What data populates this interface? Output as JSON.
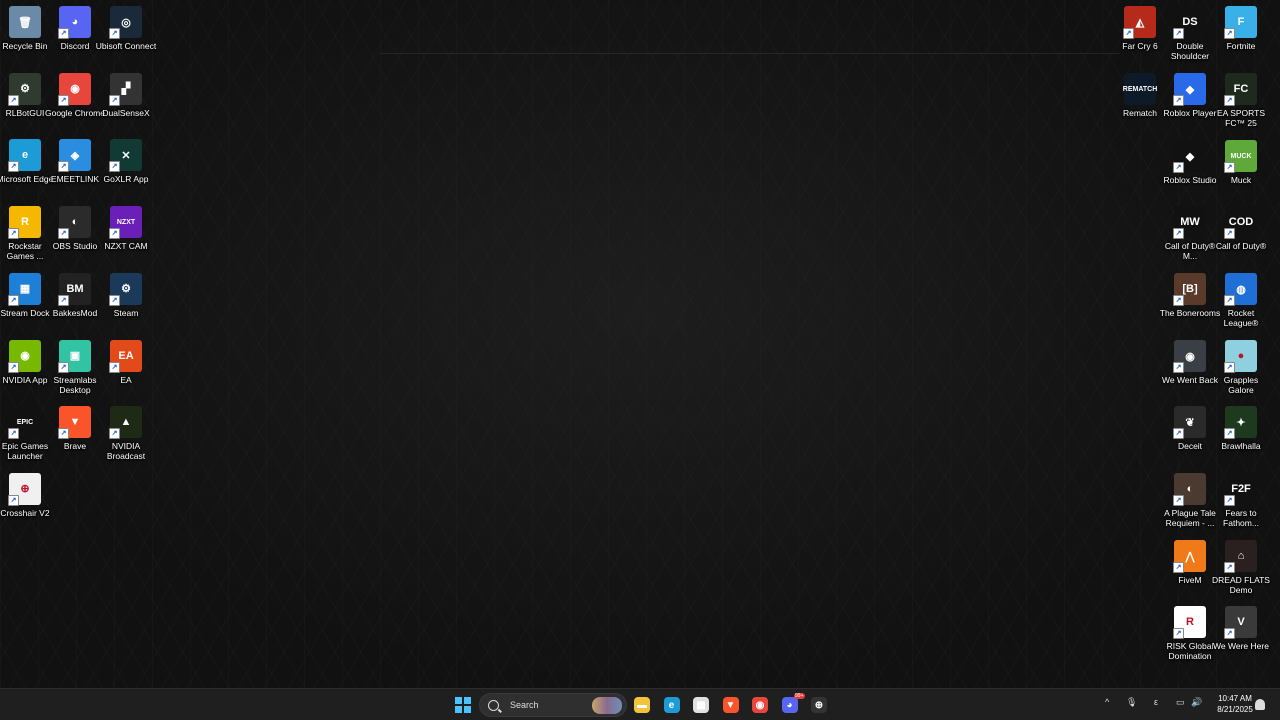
{
  "desktop": {
    "icons_left": [
      {
        "label": "Recycle Bin",
        "icon": "recycle-bin-icon",
        "bg": "#6b8aa8",
        "glyph": "🗑",
        "shortcut": false
      },
      {
        "label": "Discord",
        "icon": "discord-icon",
        "bg": "#5865f2",
        "glyph": "◕",
        "shortcut": true
      },
      {
        "label": "Ubisoft Connect",
        "icon": "ubisoft-icon",
        "bg": "#1a2a3a",
        "glyph": "◎",
        "shortcut": true
      },
      {
        "label": "RLBotGUI",
        "icon": "rlbot-icon",
        "bg": "#2e3b2e",
        "glyph": "⚙",
        "shortcut": true
      },
      {
        "label": "Google Chrome",
        "icon": "chrome-icon",
        "bg": "#e8453c",
        "glyph": "◉",
        "shortcut": true
      },
      {
        "label": "DualSenseX",
        "icon": "dualsensex-icon",
        "bg": "#333333",
        "glyph": "▞",
        "shortcut": true
      },
      {
        "label": "Microsoft Edge",
        "icon": "edge-icon",
        "bg": "#1d9bd6",
        "glyph": "e",
        "shortcut": true
      },
      {
        "label": "EMEETLINK",
        "icon": "emeetlink-icon",
        "bg": "#2a8de0",
        "glyph": "◈",
        "shortcut": true
      },
      {
        "label": "GoXLR App",
        "icon": "goxlr-icon",
        "bg": "#123a34",
        "glyph": "✕",
        "shortcut": true
      },
      {
        "label": "Rockstar Games ...",
        "icon": "rockstar-icon",
        "bg": "#f5b800",
        "glyph": "R",
        "shortcut": true
      },
      {
        "label": "OBS Studio",
        "icon": "obs-icon",
        "bg": "#2b2b2b",
        "glyph": "◐",
        "shortcut": true
      },
      {
        "label": "NZXT CAM",
        "icon": "nzxt-icon",
        "bg": "#6a1fb8",
        "glyph": "NZXT",
        "shortcut": true
      },
      {
        "label": "Stream Dock",
        "icon": "stream-dock-icon",
        "bg": "#1e7fd6",
        "glyph": "▦",
        "shortcut": true
      },
      {
        "label": "BakkesMod",
        "icon": "bakkesmod-icon",
        "bg": "#222222",
        "glyph": "BM",
        "shortcut": true
      },
      {
        "label": "Steam",
        "icon": "steam-icon",
        "bg": "#1b3a5a",
        "glyph": "⚙",
        "shortcut": true
      },
      {
        "label": "NVIDIA App",
        "icon": "nvidia-app-icon",
        "bg": "#76b900",
        "glyph": "◉",
        "shortcut": true
      },
      {
        "label": "Streamlabs Desktop",
        "icon": "streamlabs-icon",
        "bg": "#31c3a2",
        "glyph": "▣",
        "shortcut": true
      },
      {
        "label": "EA",
        "icon": "ea-icon",
        "bg": "#e34a1a",
        "glyph": "EA",
        "shortcut": true
      },
      {
        "label": "Epic Games Launcher",
        "icon": "epic-games-icon",
        "bg": "#111111",
        "glyph": "EPIC",
        "shortcut": true
      },
      {
        "label": "Brave",
        "icon": "brave-icon",
        "bg": "#fb542b",
        "glyph": "▼",
        "shortcut": true
      },
      {
        "label": "NVIDIA Broadcast",
        "icon": "nvidia-broadcast-icon",
        "bg": "#1f2a16",
        "glyph": "▲",
        "shortcut": true
      },
      {
        "label": "Crosshair V2",
        "icon": "crosshair-icon",
        "bg": "#f0f0f0",
        "glyph": "⊕",
        "shortcut": true
      }
    ],
    "icons_right": [
      {
        "label": "Far Cry 6",
        "icon": "far-cry-6-icon",
        "bg": "#b52a1a",
        "glyph": "◭",
        "shortcut": true
      },
      {
        "label": "Double Shouldcer",
        "icon": "double-shouldcer-icon",
        "bg": "#111111",
        "glyph": "DS",
        "shortcut": true
      },
      {
        "label": "Fortnite",
        "icon": "fortnite-icon",
        "bg": "#3ab0e8",
        "glyph": "F",
        "shortcut": true
      },
      {
        "label": "Rematch",
        "icon": "rematch-icon",
        "bg": "#0d1a2a",
        "glyph": "REMATCH",
        "shortcut": false
      },
      {
        "label": "Roblox Player",
        "icon": "roblox-player-icon",
        "bg": "#2a6ae8",
        "glyph": "◆",
        "shortcut": true
      },
      {
        "label": "EA SPORTS FC™ 25",
        "icon": "ea-fc25-icon",
        "bg": "#1e2a1e",
        "glyph": "FC",
        "shortcut": true
      },
      {
        "label": "Roblox Studio",
        "icon": "roblox-studio-icon",
        "bg": "#111111",
        "glyph": "◆",
        "shortcut": true
      },
      {
        "label": "Muck",
        "icon": "muck-icon",
        "bg": "#5fa83a",
        "glyph": "MUCK",
        "shortcut": true
      },
      {
        "label": "Call of Duty® M...",
        "icon": "cod-mw3-icon",
        "bg": "#111111",
        "glyph": "MW",
        "shortcut": true
      },
      {
        "label": "Call of Duty®",
        "icon": "cod-icon",
        "bg": "#111111",
        "glyph": "COD",
        "shortcut": true
      },
      {
        "label": "The Bonerooms",
        "icon": "bonerooms-icon",
        "bg": "#5a3a2a",
        "glyph": "[B]",
        "shortcut": true
      },
      {
        "label": "Rocket League®",
        "icon": "rocket-league-icon",
        "bg": "#1f6fd6",
        "glyph": "◍",
        "shortcut": true
      },
      {
        "label": "We Went Back",
        "icon": "we-went-back-icon",
        "bg": "#3a3f45",
        "glyph": "◉",
        "shortcut": true
      },
      {
        "label": "Grapples Galore",
        "icon": "grapples-galore-icon",
        "bg": "#8fd0e0",
        "glyph": "●",
        "shortcut": true
      },
      {
        "label": "Deceit",
        "icon": "deceit-icon",
        "bg": "#2a2a2a",
        "glyph": "❦",
        "shortcut": true
      },
      {
        "label": "Brawlhalla",
        "icon": "brawlhalla-icon",
        "bg": "#1e3a1e",
        "glyph": "✦",
        "shortcut": true
      },
      {
        "label": "A Plague Tale Requiem - ...",
        "icon": "plague-tale-icon",
        "bg": "#4a3a30",
        "glyph": "◐",
        "shortcut": true
      },
      {
        "label": "Fears to Fathom...",
        "icon": "fears-to-fathom-icon",
        "bg": "#111111",
        "glyph": "F2F",
        "shortcut": true
      },
      {
        "label": "FiveM",
        "icon": "fivem-icon",
        "bg": "#f07a1a",
        "glyph": "⋀",
        "shortcut": true
      },
      {
        "label": "DREAD FLATS Demo",
        "icon": "dread-flats-icon",
        "bg": "#2a2020",
        "glyph": "⌂",
        "shortcut": true
      },
      {
        "label": "RISK Global Domination",
        "icon": "risk-icon",
        "bg": "#ffffff",
        "glyph": "R",
        "shortcut": true
      },
      {
        "label": "We Were Here",
        "icon": "we-were-here-icon",
        "bg": "#3a3a3a",
        "glyph": "V",
        "shortcut": true
      }
    ]
  },
  "taskbar": {
    "search_placeholder": "Search",
    "pinned": [
      {
        "name": "file-explorer-icon",
        "bg": "#f2c33b",
        "glyph": "▬"
      },
      {
        "name": "edge-icon",
        "bg": "#1d9bd6",
        "glyph": "e"
      },
      {
        "name": "microsoft-store-icon",
        "bg": "#e0e0e0",
        "glyph": "▦"
      },
      {
        "name": "brave-icon",
        "bg": "#fb542b",
        "glyph": "▼"
      },
      {
        "name": "chrome-icon",
        "bg": "#e8453c",
        "glyph": "◉"
      },
      {
        "name": "discord-icon",
        "bg": "#5865f2",
        "glyph": "◕",
        "badge": "99+"
      },
      {
        "name": "crosshair-icon",
        "bg": "#333333",
        "glyph": "⊕"
      }
    ],
    "tray": {
      "chevron": "^",
      "mic": "🎙",
      "lang": "ε",
      "network": "▭",
      "volume": "🔊",
      "battery": "▮"
    },
    "clock": {
      "time": "10:47 AM",
      "date": "8/21/2025"
    }
  }
}
